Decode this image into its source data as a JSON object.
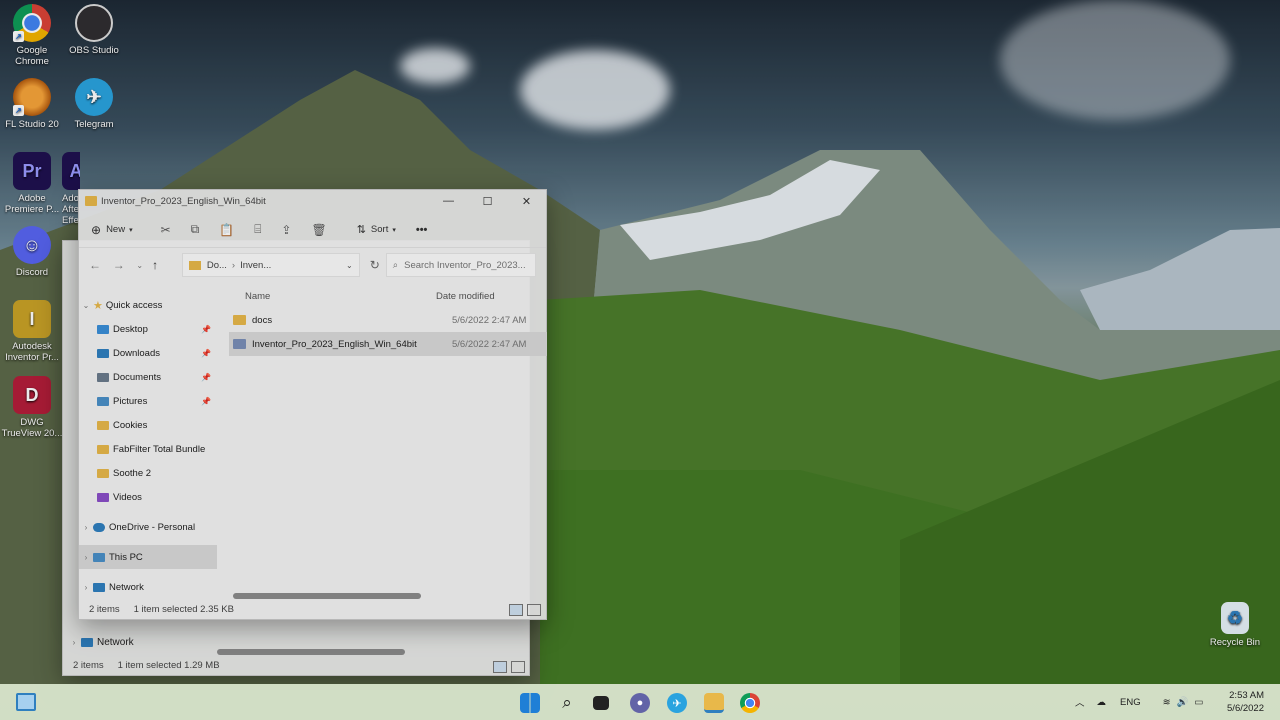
{
  "desktop": {
    "icons": [
      {
        "label": "Google Chrome",
        "glyph": "",
        "color": "#db4437"
      },
      {
        "label": "OBS Studio",
        "glyph": "",
        "color": "#302e31"
      },
      {
        "label": "FL Studio 20",
        "glyph": "",
        "color": "#f18a1c"
      },
      {
        "label": "Telegram",
        "glyph": "✈",
        "color": "#2aa3df"
      },
      {
        "label": "Adobe Premiere P...",
        "glyph": "Pr",
        "color": "#1f1150"
      },
      {
        "label": "Adobe After Effects",
        "glyph": "Ae",
        "color": "#1f1150"
      },
      {
        "label": "Discord",
        "glyph": "☺",
        "color": "#5865f2"
      },
      {
        "label": "Autodesk Inventor Pr...",
        "glyph": "I",
        "color": "#c9a227"
      },
      {
        "label": "DWG TrueView 20...",
        "glyph": "D",
        "color": "#b41e3a"
      },
      {
        "label": "Recycle Bin",
        "glyph": "♻",
        "color": "#cfe6f5"
      }
    ]
  },
  "front_window": {
    "title": "Inventor_Pro_2023_English_Win_64bit",
    "toolbar": {
      "new_label": "New",
      "sort_label": "Sort",
      "more_label": "•••"
    },
    "address": {
      "crumb1": "Do...",
      "crumb2": "Inven...",
      "search_placeholder": "Search Inventor_Pro_2023..."
    },
    "nav": {
      "quick_access": "Quick access",
      "items": [
        {
          "label": "Desktop",
          "pinned": "📌",
          "color": "#3a8fd8"
        },
        {
          "label": "Downloads",
          "pinned": "📌",
          "color": "#2f7fbf"
        },
        {
          "label": "Documents",
          "pinned": "📌",
          "color": "#6b7b8c"
        },
        {
          "label": "Pictures",
          "pinned": "📌",
          "color": "#4a90c8"
        },
        {
          "label": "Cookies",
          "pinned": "",
          "color": "#e8b84a"
        },
        {
          "label": "FabFilter Total Bundle",
          "pinned": "",
          "color": "#e8b84a"
        },
        {
          "label": "Soothe 2",
          "pinned": "",
          "color": "#e8b84a"
        },
        {
          "label": "Videos",
          "pinned": "",
          "color": "#8a4fc8"
        }
      ],
      "onedrive": "OneDrive - Personal",
      "this_pc": "This PC",
      "network": "Network"
    },
    "columns": {
      "name": "Name",
      "date": "Date modified"
    },
    "files": [
      {
        "name": "docs",
        "date": "5/6/2022 2:47 AM"
      },
      {
        "name": "Inventor_Pro_2023_English_Win_64bit",
        "date": "5/6/2022 2:47 AM"
      }
    ],
    "status": {
      "items": "2 items",
      "selected": "1 item selected  2.35 KB"
    }
  },
  "back_window": {
    "network": "Network",
    "status": {
      "items": "2 items",
      "selected": "1 item selected  1.29 MB"
    }
  },
  "taskbar": {
    "lang": "ENG",
    "time": "2:53 AM",
    "date": "5/6/2022"
  }
}
